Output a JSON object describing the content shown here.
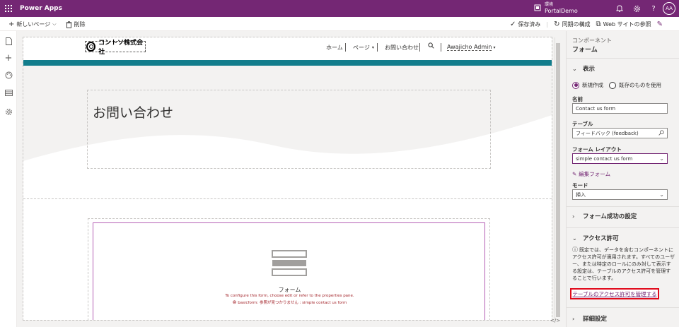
{
  "app": {
    "title": "Power Apps"
  },
  "environment": {
    "label": "環境",
    "name": "PortalDemo"
  },
  "user": {
    "initials": "AA"
  },
  "toolbar": {
    "new_page": "新しいページ",
    "delete": "削除",
    "saved": "保存済み",
    "sync": "同期の構成",
    "browse": "Web サイトの参照"
  },
  "site": {
    "logo_text": "コントソ株式会社",
    "nav": [
      "ホーム",
      "ページ",
      "お問い合わせ"
    ],
    "user_menu": "Awajicho Admin",
    "hero_title": "お問い合わせ"
  },
  "form_placeholder": {
    "label": "フォーム",
    "hint": "To configure this form, choose edit or refer to the properties pane.",
    "error": "basicform: 参照が見つかりません : simple contact us form"
  },
  "code_button": "</>",
  "panel": {
    "subtitle": "コンポーネント",
    "title": "フォーム",
    "display_section": "表示",
    "radio_new": "新規作成",
    "radio_existing": "既存のものを使用",
    "name_label": "名前",
    "name_value": "Contact us form",
    "table_label": "テーブル",
    "table_value": "フィードバック (feedback)",
    "layout_label": "フォーム レイアウト",
    "layout_value": "simple contact us form",
    "edit_form": "編集フォーム",
    "mode_label": "モード",
    "mode_value": "挿入",
    "success_section": "フォーム成功の設定",
    "permissions_section": "アクセス許可",
    "permissions_info": "既定では、データを含むコンポーネントにアクセス許可が適用されます。すべてのユーザー、または特定のロールにのみ対して表示する設定は、テーブルのアクセス許可を管理することで行います。",
    "manage_permissions": "テーブルのアクセス許可を管理する",
    "advanced_section": "詳細設定"
  },
  "colors": {
    "brand": "#742774",
    "teal": "#127d8c",
    "highlight": "#e00b1c"
  }
}
